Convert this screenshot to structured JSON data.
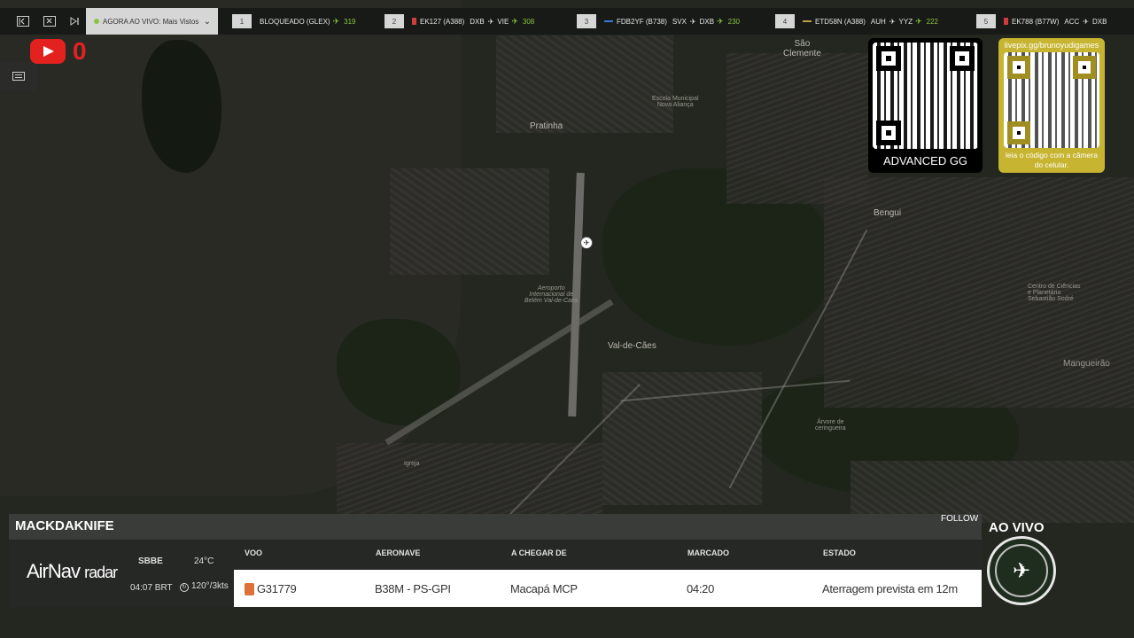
{
  "topbar": {
    "live_label": "AGORA AO VIVO: Mais Vistos",
    "slots": [
      {
        "num": "1",
        "flight": "BLOQUEADO (GLEX)",
        "route": "",
        "count": "319",
        "color": "#c9c9c9"
      },
      {
        "num": "2",
        "flight": "EK127 (A388)",
        "route_from": "DXB",
        "route_to": "VIE",
        "count": "308",
        "color": "#d23b3b"
      },
      {
        "num": "3",
        "flight": "FDB2YF (B738)",
        "route_from": "SVX",
        "route_to": "DXB",
        "count": "230",
        "color": "#3b79d2"
      },
      {
        "num": "4",
        "flight": "ETD58N (A388)",
        "route_from": "AUH",
        "route_to": "YYZ",
        "count": "222",
        "color": "#b8a24a"
      },
      {
        "num": "5",
        "flight": "EK788 (B77W)",
        "route_from": "ACC",
        "route_to": "DXB",
        "count": "",
        "color": "#d23b3b"
      }
    ]
  },
  "youtube": {
    "count": "0"
  },
  "map": {
    "labels": {
      "sao_clemente": "São\nClemente",
      "pratinha": "Pratinha",
      "airport": "Aeroporto\nInternacional de\nBelém Val-de-Cans",
      "val_de_caes": "Val-de-Cães",
      "bengui": "Bengui",
      "mangueirao": "Mangueirão",
      "escola": "Escola Municipal\nNova Aliança",
      "arvore": "Árvore de\nceringueira",
      "centro": "Centro de Ciências\ne Planetário\nSebastião Sodré",
      "igreja": "Igreja"
    }
  },
  "qr_codes": {
    "advanced_label": "ADVANCED GG",
    "livepix_url": "livepix.gg/brunoyudigames",
    "livepix_caption": "leia o código com a câmera do celular."
  },
  "panel": {
    "username": "MACKDAKNIFE",
    "follow": "FOLLOW",
    "airnav": {
      "brand": "AirNav",
      "sub": "radar"
    },
    "station": "SBBE",
    "temp": "24°C",
    "time": "04:07 BRT",
    "wind": "120°/3kts",
    "columns": {
      "flight": "VOO",
      "aircraft": "AERONAVE",
      "from": "A CHEGAR DE",
      "scheduled": "MARCADO",
      "status": "ESTADO"
    },
    "row": {
      "flight": "G31779",
      "aircraft": "B38M - PS-GPI",
      "from": "Macapá MCP",
      "scheduled": "04:20",
      "status": "Aterragem prevista em 12m"
    }
  },
  "live": {
    "label": "AO VIVO"
  }
}
